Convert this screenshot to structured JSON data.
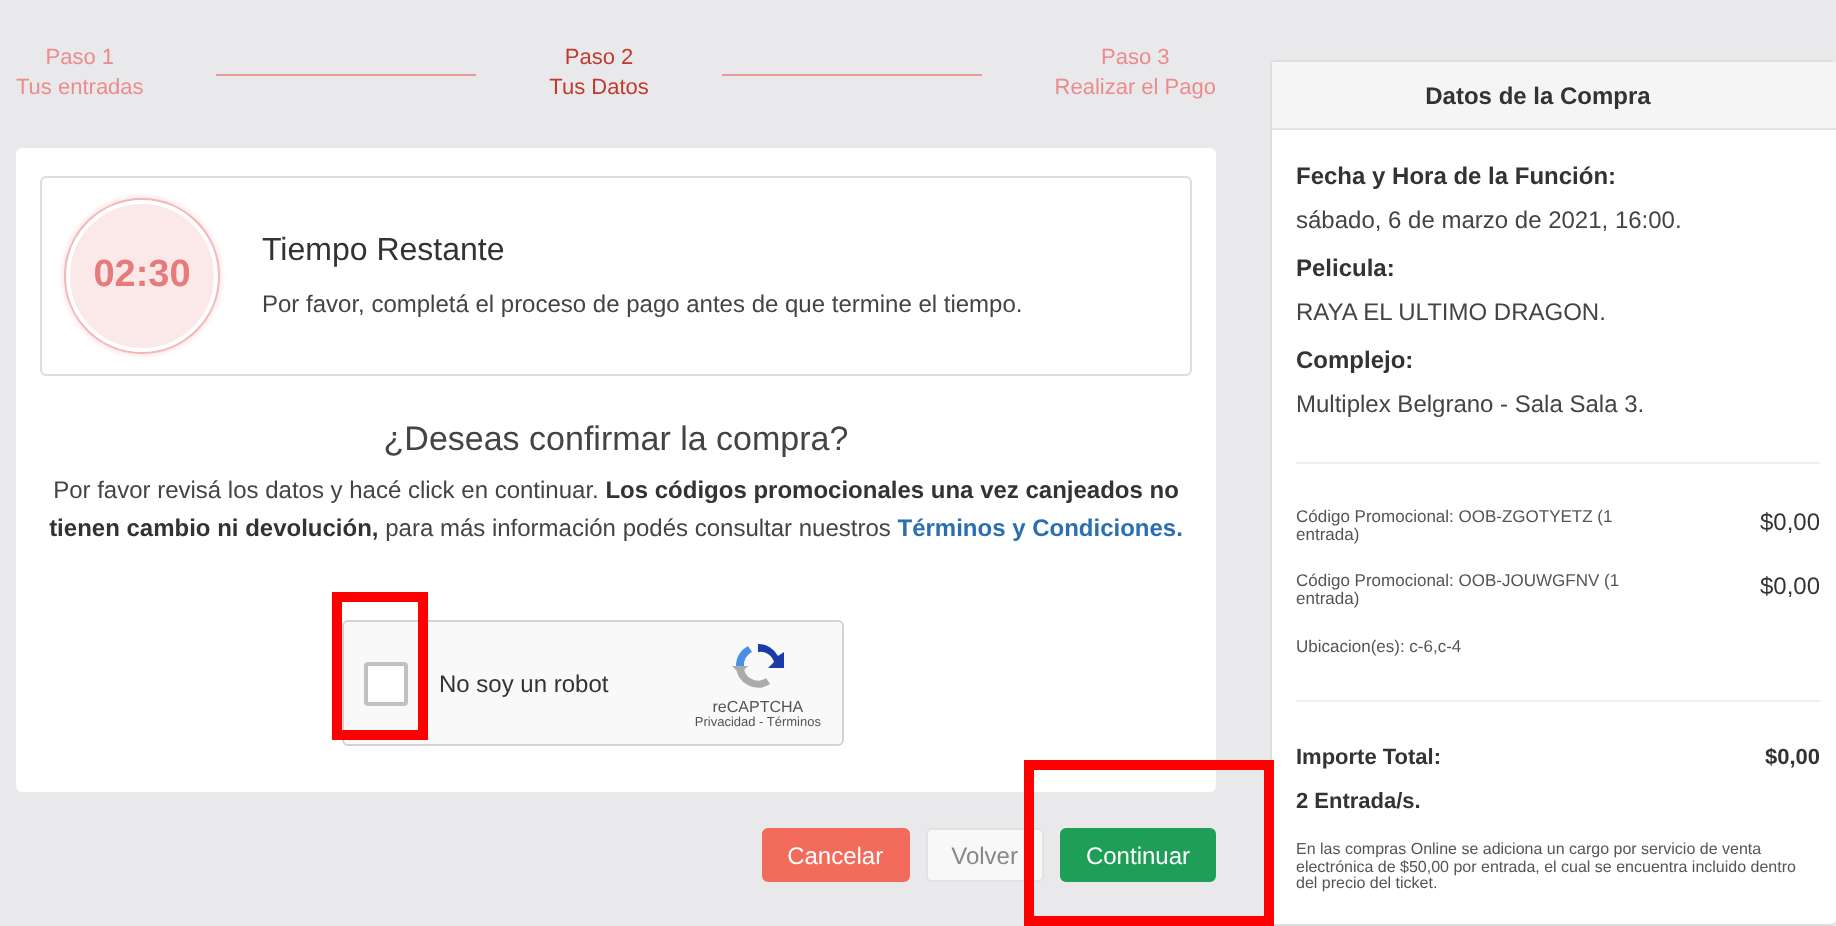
{
  "steps": [
    {
      "number": "Paso 1",
      "label": "Tus entradas",
      "selected": false
    },
    {
      "number": "Paso 2",
      "label": "Tus Datos",
      "selected": true
    },
    {
      "number": "Paso 3",
      "label": "Realizar el Pago",
      "selected": false
    }
  ],
  "timer": {
    "time": "02:30",
    "title": "Tiempo Restante",
    "message": "Por favor, completá el proceso de pago antes de que termine el tiempo."
  },
  "confirm": {
    "title": "¿Deseas confirmar la compra?",
    "text": "Por favor revisá los datos y hacé click en continuar. **Los códigos promocionales una vez canjeados no tienen cambio ni devolución,** para más información podés consultar nuestros ",
    "link": "Términos y Condiciones."
  },
  "captcha": {
    "label": "No soy un robot",
    "checked": false,
    "brand": "reCAPTCHA",
    "links": "Privacidad - Términos"
  },
  "buttons": [
    {
      "label": "Cancelar",
      "kind": "danger"
    },
    {
      "label": "Volver",
      "kind": "plain"
    },
    {
      "label": "Continuar",
      "kind": "success"
    }
  ],
  "summary": {
    "title": "Datos de la Compra",
    "fields": [
      {
        "label": "Fecha y Hora de la Función:",
        "value": "sábado, 6 de marzo de 2021, 16:00."
      },
      {
        "label": "Pelicula:",
        "value": "RAYA EL ULTIMO DRAGON."
      },
      {
        "label": "Complejo:",
        "value": "Multiplex Belgrano - Sala Sala 3."
      }
    ],
    "items": [
      {
        "description": "Código Promocional: OOB-ZGOTYETZ (1 entrada)",
        "amount": "$0,00"
      },
      {
        "description": "Código Promocional: OOB-JOUWGFNV (1 entrada)",
        "amount": "$0,00"
      }
    ],
    "seats": "Ubicacion(es): c-6,c-4",
    "total_label": "Importe Total:",
    "total": "$0,00",
    "tickets": "2 Entrada/s.",
    "note": "En las compras Online se adiciona un cargo por servicio de venta electrónica de $50,00 por entrada, el cual se encuentra incluido dentro del precio del ticket."
  },
  "annotations": [
    {
      "kind": "frame"
    },
    {
      "kind": "frame"
    }
  ]
}
